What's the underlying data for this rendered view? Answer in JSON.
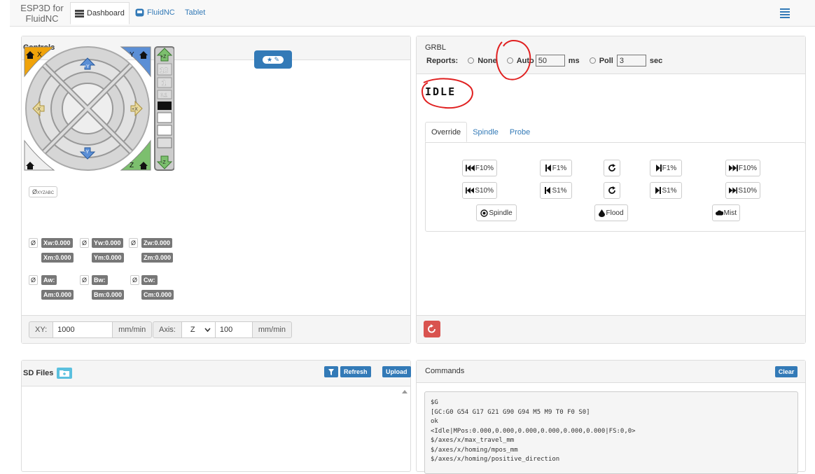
{
  "app": {
    "brand_line1": "ESP3D for",
    "brand_line2": "FluidNC"
  },
  "nav": {
    "tabs": [
      {
        "label": "Dashboard"
      },
      {
        "label": "FluidNC"
      },
      {
        "label": "Tablet"
      }
    ]
  },
  "controls": {
    "title": "Controls",
    "jog": {
      "x_home": "X",
      "y_home": "Y",
      "z_home": "Z",
      "minus_x": "-X",
      "plus_x": "+X",
      "plus_y": "+Y",
      "minus_y": "-Y",
      "plus_z": "+Z",
      "minus_z": "-Z",
      "steps": [
        "10",
        "1",
        "0.1"
      ]
    },
    "zero_all_label": "Ø",
    "zero_all_axes": "XYZABC",
    "axes": [
      {
        "zero": "Ø",
        "w": "Xw:0.000",
        "m": "Xm:0.000"
      },
      {
        "zero": "Ø",
        "w": "Yw:0.000",
        "m": "Ym:0.000"
      },
      {
        "zero": "Ø",
        "w": "Zw:0.000",
        "m": "Zm:0.000"
      },
      {
        "zero": "Ø",
        "w": "Aw:",
        "m": "Am:0.000"
      },
      {
        "zero": "Ø",
        "w": "Bw:",
        "m": "Bm:0.000"
      },
      {
        "zero": "Ø",
        "w": "Cw:",
        "m": "Cm:0.000"
      }
    ],
    "footer": {
      "xy_label": "XY:",
      "xy_value": "1000",
      "xy_unit": "mm/min",
      "axis_label": "Axis:",
      "axis_value": "Z",
      "axis_feed": "100",
      "axis_unit": "mm/min"
    }
  },
  "grbl": {
    "title": "GRBL",
    "reports_label": "Reports:",
    "opt_none": "None",
    "opt_auto": "Auto",
    "auto_value": "50",
    "auto_unit": "ms",
    "opt_poll": "Poll",
    "poll_value": "3",
    "poll_unit": "sec",
    "state": "Idle",
    "tabs": [
      "Override",
      "Spindle",
      "Probe"
    ],
    "feed": {
      "minus10": "F10%",
      "minus1": "F1%",
      "plus1": "F1%",
      "plus10": "F10%"
    },
    "speed": {
      "minus10": "S10%",
      "minus1": "S1%",
      "plus1": "S1%",
      "plus10": "S10%"
    },
    "spindle": "Spindle",
    "flood": "Flood",
    "mist": "Mist"
  },
  "sd": {
    "title": "SD Files",
    "refresh": "Refresh",
    "upload": "Upload"
  },
  "commands": {
    "title": "Commands",
    "clear": "Clear",
    "lines": [
      "$G",
      "[GC:G0 G54 G17 G21 G90 G94 M5 M9 T0 F0 S0]",
      "ok",
      "<Idle|MPos:0.000,0.000,0.000,0.000,0.000,0.000|FS:0,0>",
      "$/axes/x/max_travel_mm",
      "$/axes/x/homing/mpos_mm",
      "$/axes/x/homing/positive_direction"
    ]
  },
  "colors": {
    "primary": "#337ab7",
    "danger": "#d9534f",
    "home_x": "#f0a30a",
    "home_y": "#5b8fd6",
    "home_z": "#7cbf6e"
  }
}
